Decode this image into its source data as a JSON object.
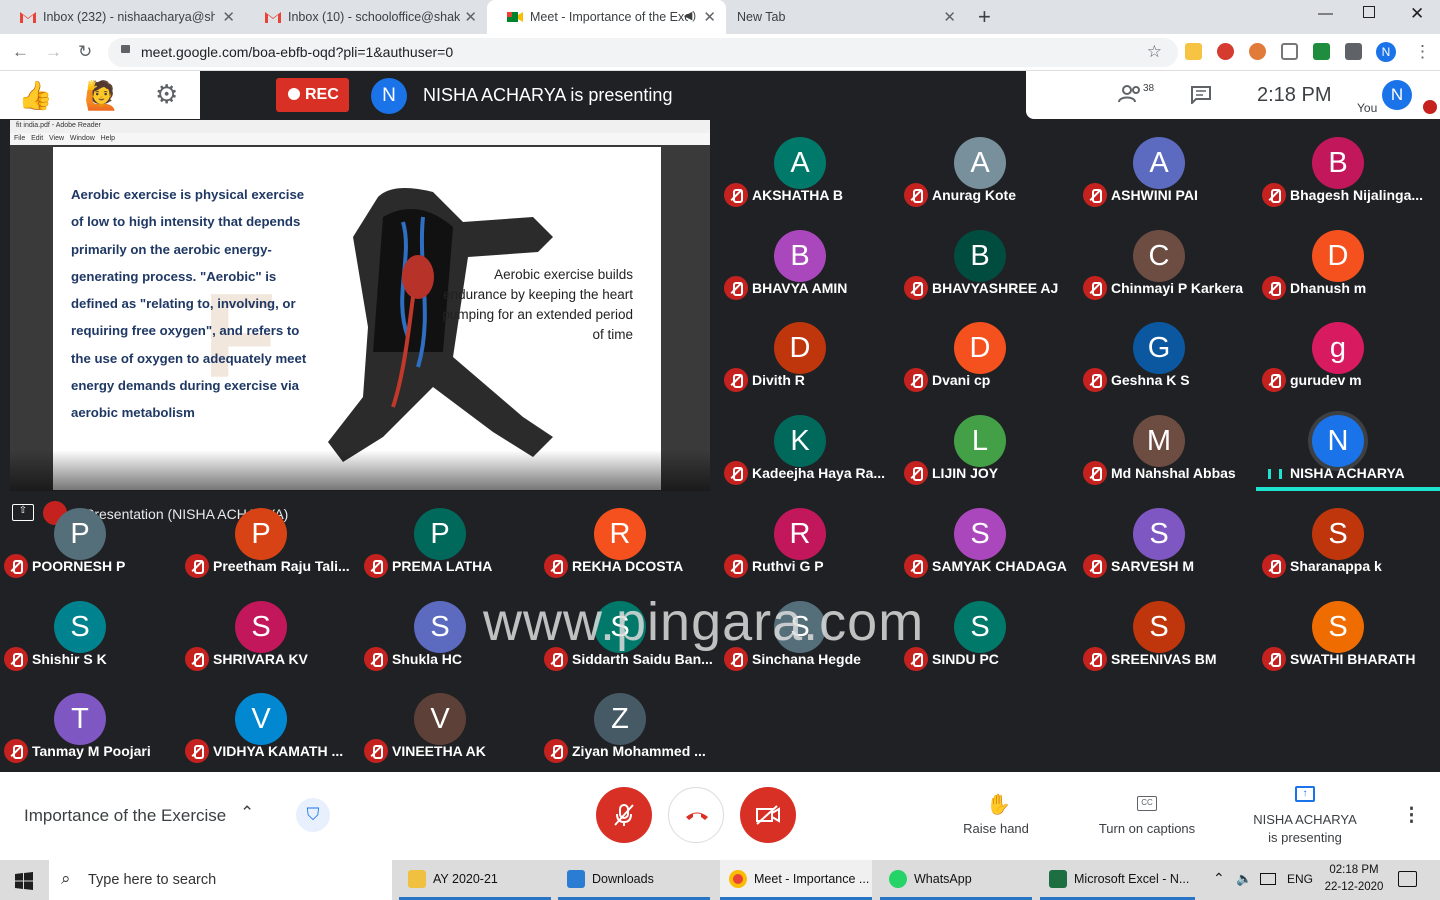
{
  "browser": {
    "tabs": [
      {
        "label": "Inbox (232) - nishaacharya@shak",
        "icon": "gmail-icon"
      },
      {
        "label": "Inbox (10) - schooloffice@shakth",
        "icon": "gmail-icon"
      },
      {
        "label": "Meet - Importance of the Exe",
        "icon": "meet-icon",
        "active": true
      },
      {
        "label": "New Tab",
        "icon": "none"
      }
    ],
    "url": "meet.google.com/boa-ebfb-oqd?pli=1&authuser=0",
    "profile_initial": "N"
  },
  "meet": {
    "rec_label": "REC",
    "presenter_initial": "N",
    "presenting_text": "NISHA ACHARYA is presenting",
    "participant_count": "38",
    "time": "2:18 PM",
    "you_label": "You",
    "you_initial": "N",
    "presentation_caption": "Presentation (NISHA ACHARYA)",
    "slide": {
      "window_title": "fit india.pdf - Adobe Reader",
      "menu": "File   Edit   View   Window   Help",
      "left_text": "Aerobic exercise is physical exercise of low to high intensity that depends primarily on the aerobic energy-generating process. \"Aerobic\" is defined as \"relating to, involving, or requiring free oxygen\", and refers to the use of oxygen to adequately meet energy demands during exercise via aerobic metabolism",
      "right_text": "Aerobic exercise builds endurance by keeping the heart pumping for an extended period of time"
    },
    "participants": [
      {
        "initial": "A",
        "name": "AKSHATHA B",
        "color": "#00796b"
      },
      {
        "initial": "A",
        "name": "Anurag Kote",
        "color": "#78909c"
      },
      {
        "initial": "A",
        "name": "ASHWINI PAI",
        "color": "#5c6bc0"
      },
      {
        "initial": "B",
        "name": "Bhagesh Nijalinga...",
        "color": "#c2185b"
      },
      {
        "initial": "B",
        "name": "BHAVYA AMIN",
        "color": "#ab47bc"
      },
      {
        "initial": "B",
        "name": "BHAVYASHREE AJ",
        "color": "#004d40"
      },
      {
        "initial": "C",
        "name": "Chinmayi P Karkera",
        "color": "#6d4c41"
      },
      {
        "initial": "D",
        "name": "Dhanush m",
        "color": "#f4511e"
      },
      {
        "initial": "D",
        "name": "Divith R",
        "color": "#bf360c"
      },
      {
        "initial": "D",
        "name": "Dvani cp",
        "color": "#f4511e"
      },
      {
        "initial": "G",
        "name": "Geshna K S",
        "color": "#0b57a0"
      },
      {
        "initial": "g",
        "name": "gurudev m",
        "color": "#d81b60"
      },
      {
        "initial": "K",
        "name": "Kadeejha Haya Ra...",
        "color": "#00695c"
      },
      {
        "initial": "L",
        "name": "LIJIN JOY",
        "color": "#43a047"
      },
      {
        "initial": "M",
        "name": "Md Nahshal Abbas",
        "color": "#6d4c41"
      },
      {
        "initial": "N",
        "name": "NISHA ACHARYA",
        "color": "#1a73e8",
        "speaking": true
      },
      {
        "initial": "P",
        "name": "POORNESH P",
        "color": "#546e7a"
      },
      {
        "initial": "P",
        "name": "Preetham Raju Tali...",
        "color": "#d84315"
      },
      {
        "initial": "P",
        "name": "PREMA LATHA",
        "color": "#00695c"
      },
      {
        "initial": "R",
        "name": "REKHA DCOSTA",
        "color": "#f4511e"
      },
      {
        "initial": "R",
        "name": "Ruthvi G P",
        "color": "#c2185b"
      },
      {
        "initial": "S",
        "name": "SAMYAK CHADAGA",
        "color": "#ab47bc"
      },
      {
        "initial": "S",
        "name": "SARVESH M",
        "color": "#7e57c2"
      },
      {
        "initial": "S",
        "name": "Sharanappa k",
        "color": "#bf360c"
      },
      {
        "initial": "S",
        "name": "Shishir S K",
        "color": "#00838f"
      },
      {
        "initial": "S",
        "name": "SHRIVARA KV",
        "color": "#c2185b"
      },
      {
        "initial": "S",
        "name": "Shukla HC",
        "color": "#5c6bc0"
      },
      {
        "initial": "S",
        "name": "Siddarth Saidu Ban...",
        "color": "#00796b"
      },
      {
        "initial": "S",
        "name": "Sinchana Hegde",
        "color": "#546e7a"
      },
      {
        "initial": "S",
        "name": "SINDU PC",
        "color": "#00796b"
      },
      {
        "initial": "S",
        "name": "SREENIVAS BM",
        "color": "#bf360c"
      },
      {
        "initial": "S",
        "name": "SWATHI BHARATH",
        "color": "#ef6c00"
      },
      {
        "initial": "T",
        "name": "Tanmay M Poojari",
        "color": "#7e57c2"
      },
      {
        "initial": "V",
        "name": "VIDHYA KAMATH ...",
        "color": "#0288d1"
      },
      {
        "initial": "V",
        "name": "VINEETHA AK",
        "color": "#5d4037"
      },
      {
        "initial": "Z",
        "name": "Ziyan Mohammed ...",
        "color": "#455a64"
      }
    ],
    "watermark": "www.pingara.com",
    "meeting_title": "Importance of the Exercise",
    "raise_hand": "Raise hand",
    "captions": "Turn on captions",
    "present_line1": "NISHA ACHARYA",
    "present_line2": "is presenting"
  },
  "taskbar": {
    "search_placeholder": "Type here to search",
    "items": [
      {
        "label": "AY 2020-21",
        "icon": "folder-icon",
        "color": "#f0c040"
      },
      {
        "label": "Downloads",
        "icon": "download-icon",
        "color": "#2b7cd3"
      },
      {
        "label": "Meet - Importance ...",
        "icon": "chrome-icon",
        "color": "#ea4335"
      },
      {
        "label": "WhatsApp",
        "icon": "whatsapp-icon",
        "color": "#25d366"
      },
      {
        "label": "Microsoft Excel - N...",
        "icon": "excel-icon",
        "color": "#1d6f42"
      }
    ],
    "lang": "ENG",
    "time": "02:18 PM",
    "date": "22-12-2020"
  }
}
